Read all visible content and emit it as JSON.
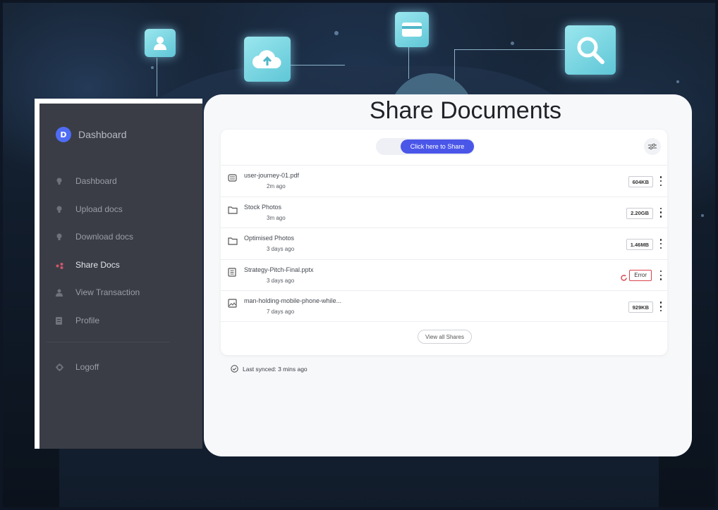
{
  "sidebar": {
    "brand_logo": "D",
    "brand_title": "Dashboard",
    "items": [
      {
        "label": "Dashboard",
        "icon": "bulb-icon"
      },
      {
        "label": "Upload docs",
        "icon": "bulb-icon"
      },
      {
        "label": "Download docs",
        "icon": "bulb-icon"
      },
      {
        "label": "Share Docs",
        "icon": "share-icon",
        "active": true
      },
      {
        "label": "View Transaction",
        "icon": "user-icon"
      },
      {
        "label": "Profile",
        "icon": "document-icon"
      }
    ],
    "logoff_label": "Logoff"
  },
  "main": {
    "title": "Share Documents",
    "share_button": "Click here to Share",
    "files": [
      {
        "name": "user-journey-01.pdf",
        "time": "2m ago",
        "size": "604KB",
        "icon": "pdf-icon"
      },
      {
        "name": "Stock Photos",
        "time": "3m ago",
        "size": "2.20GB",
        "icon": "folder-icon"
      },
      {
        "name": "Optimised Photos",
        "time": "3 days ago",
        "size": "1.46MB",
        "icon": "folder-icon"
      },
      {
        "name": "Strategy-Pitch-Final.pptx",
        "time": "3 days ago",
        "status": "Error",
        "icon": "presentation-icon"
      },
      {
        "name": "man-holding-mobile-phone-while...",
        "time": "7 days ago",
        "size": "929KB",
        "icon": "image-icon"
      }
    ],
    "view_all": "View all Shares",
    "sync_status": "Last synced: 3 mins ago"
  },
  "colors": {
    "accent": "#4a56e8",
    "sidebar_bg": "#3a3d46",
    "error": "#d9434e"
  }
}
